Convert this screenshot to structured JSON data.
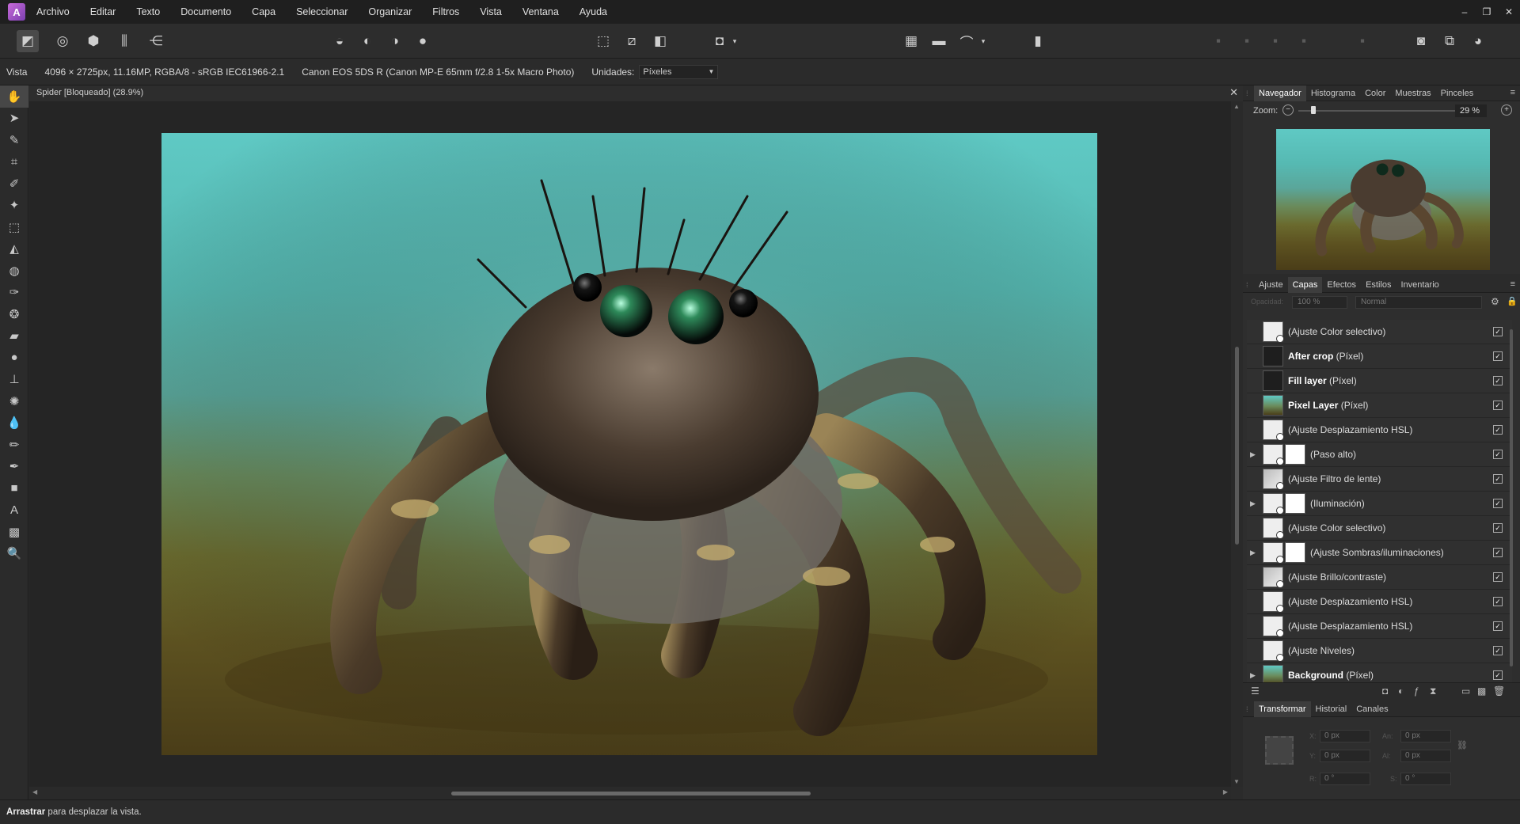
{
  "app": {
    "menu": [
      "Archivo",
      "Editar",
      "Texto",
      "Documento",
      "Capa",
      "Seleccionar",
      "Organizar",
      "Filtros",
      "Vista",
      "Ventana",
      "Ayuda"
    ],
    "window_controls": [
      "–",
      "❐",
      "✕"
    ]
  },
  "context": {
    "tool_name": "Vista",
    "image_info": "4096 × 2725px, 11.16MP, RGBA/8 - sRGB IEC61966-2.1",
    "camera_info": "Canon EOS 5DS R (Canon MP-E 65mm f/2.8 1-5x Macro Photo)",
    "units_label": "Unidades:",
    "units_value": "Píxeles"
  },
  "document": {
    "title": "Spider [Bloqueado] (28.9%)"
  },
  "status": {
    "bold": "Arrastrar",
    "text": " para desplazar la vista."
  },
  "navigator": {
    "tabs": [
      "Navegador",
      "Histograma",
      "Color",
      "Muestras",
      "Pinceles"
    ],
    "zoom_label": "Zoom:",
    "zoom_value": "29 %",
    "zoom_percent": 29
  },
  "layers_panel": {
    "tabs": [
      "Ajuste",
      "Capas",
      "Efectos",
      "Estilos",
      "Inventario"
    ],
    "opacity_label": "Opacidad:",
    "opacity": "100 %",
    "blend_mode": "Normal",
    "layers": [
      {
        "name": "",
        "type": "(Ajuste Color selectivo)",
        "bold": false,
        "expander": false,
        "thumb": "white",
        "mask": false
      },
      {
        "name": "After crop",
        "type": " (Píxel)",
        "bold": true,
        "expander": false,
        "thumb": "dark",
        "mask": false
      },
      {
        "name": "Fill layer",
        "type": " (Píxel)",
        "bold": true,
        "expander": false,
        "thumb": "dark",
        "mask": false
      },
      {
        "name": "Pixel Layer",
        "type": " (Píxel)",
        "bold": true,
        "expander": false,
        "thumb": "photo",
        "mask": false
      },
      {
        "name": "",
        "type": "(Ajuste Desplazamiento HSL)",
        "bold": false,
        "expander": false,
        "thumb": "white",
        "mask": false
      },
      {
        "name": "",
        "type": "(Paso alto)",
        "bold": false,
        "expander": true,
        "thumb": "white",
        "mask": true
      },
      {
        "name": "",
        "type": "(Ajuste Filtro de lente)",
        "bold": false,
        "expander": false,
        "thumb": "gray",
        "mask": false
      },
      {
        "name": "",
        "type": "(Iluminación)",
        "bold": false,
        "expander": true,
        "thumb": "white",
        "mask": true
      },
      {
        "name": "",
        "type": "(Ajuste Color selectivo)",
        "bold": false,
        "expander": false,
        "thumb": "white",
        "mask": false
      },
      {
        "name": "",
        "type": "(Ajuste Sombras/iluminaciones)",
        "bold": false,
        "expander": true,
        "thumb": "white",
        "mask": true
      },
      {
        "name": "",
        "type": "(Ajuste Brillo/contraste)",
        "bold": false,
        "expander": false,
        "thumb": "gray",
        "mask": false
      },
      {
        "name": "",
        "type": "(Ajuste Desplazamiento HSL)",
        "bold": false,
        "expander": false,
        "thumb": "white",
        "mask": false
      },
      {
        "name": "",
        "type": "(Ajuste Desplazamiento HSL)",
        "bold": false,
        "expander": false,
        "thumb": "white",
        "mask": false
      },
      {
        "name": "",
        "type": "(Ajuste Niveles)",
        "bold": false,
        "expander": false,
        "thumb": "white",
        "mask": false
      },
      {
        "name": "Background",
        "type": " (Píxel)",
        "bold": true,
        "expander": true,
        "thumb": "photo",
        "mask": false
      }
    ]
  },
  "transform_panel": {
    "tabs": [
      "Transformar",
      "Historial",
      "Canales"
    ],
    "x_label": "X:",
    "x": "0 px",
    "y_label": "Y:",
    "y": "0 px",
    "w_label": "An:",
    "w": "0 px",
    "h_label": "Al:",
    "h": "0 px",
    "r_label": "R:",
    "r": "0 °",
    "s_label": "S:",
    "s": "0 °"
  }
}
